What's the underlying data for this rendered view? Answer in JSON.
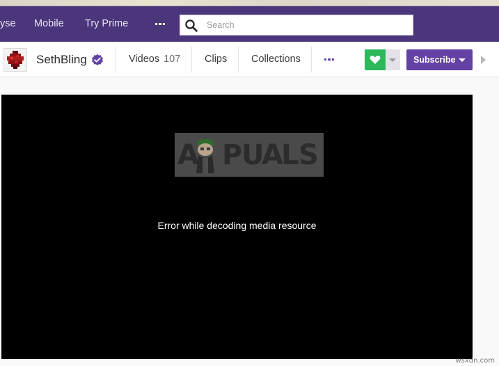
{
  "topnav": {
    "browse_label": "yse",
    "mobile_label": "Mobile",
    "prime_label": "Try Prime",
    "more_icon": "ellipsis-icon",
    "search": {
      "placeholder": "Search",
      "value": "",
      "icon": "search-icon"
    }
  },
  "channel": {
    "name": "SethBling",
    "verified_icon": "verified-check-icon",
    "tabs": {
      "videos": {
        "label": "Videos",
        "count": "107"
      },
      "clips": {
        "label": "Clips"
      },
      "collections": {
        "label": "Collections"
      }
    },
    "subscribe_label": "Subscribe",
    "follow_icon": "heart-icon"
  },
  "player": {
    "error_message": "Error while decoding media resource",
    "watermark_text": "A PUALS"
  },
  "credit": "wsxdn.com",
  "colors": {
    "nav_bg": "#4b367c",
    "brand_purple": "#6441a4",
    "follow_green": "#2db85a",
    "player_bg": "#000000"
  }
}
